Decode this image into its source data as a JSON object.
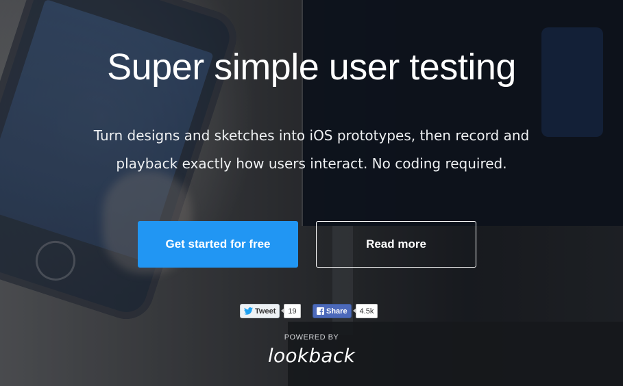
{
  "hero": {
    "title": "Super simple user testing",
    "subtitle_line1": "Turn designs and sketches into iOS prototypes, then record and",
    "subtitle_line2": "playback exactly how users interact. No coding required."
  },
  "buttons": {
    "primary_label": "Get started for free",
    "secondary_label": "Read more"
  },
  "social": {
    "tweet_label": "Tweet",
    "tweet_count": "19",
    "share_label": "Share",
    "share_count": "4.5k"
  },
  "footer": {
    "powered_by": "POWERED BY",
    "brand": "lookback"
  },
  "colors": {
    "primary": "#2196f3",
    "facebook": "#4c69ba",
    "twitter": "#1da1f2"
  },
  "icons": {
    "tweet": "twitter-bird-icon",
    "share": "facebook-f-icon"
  }
}
